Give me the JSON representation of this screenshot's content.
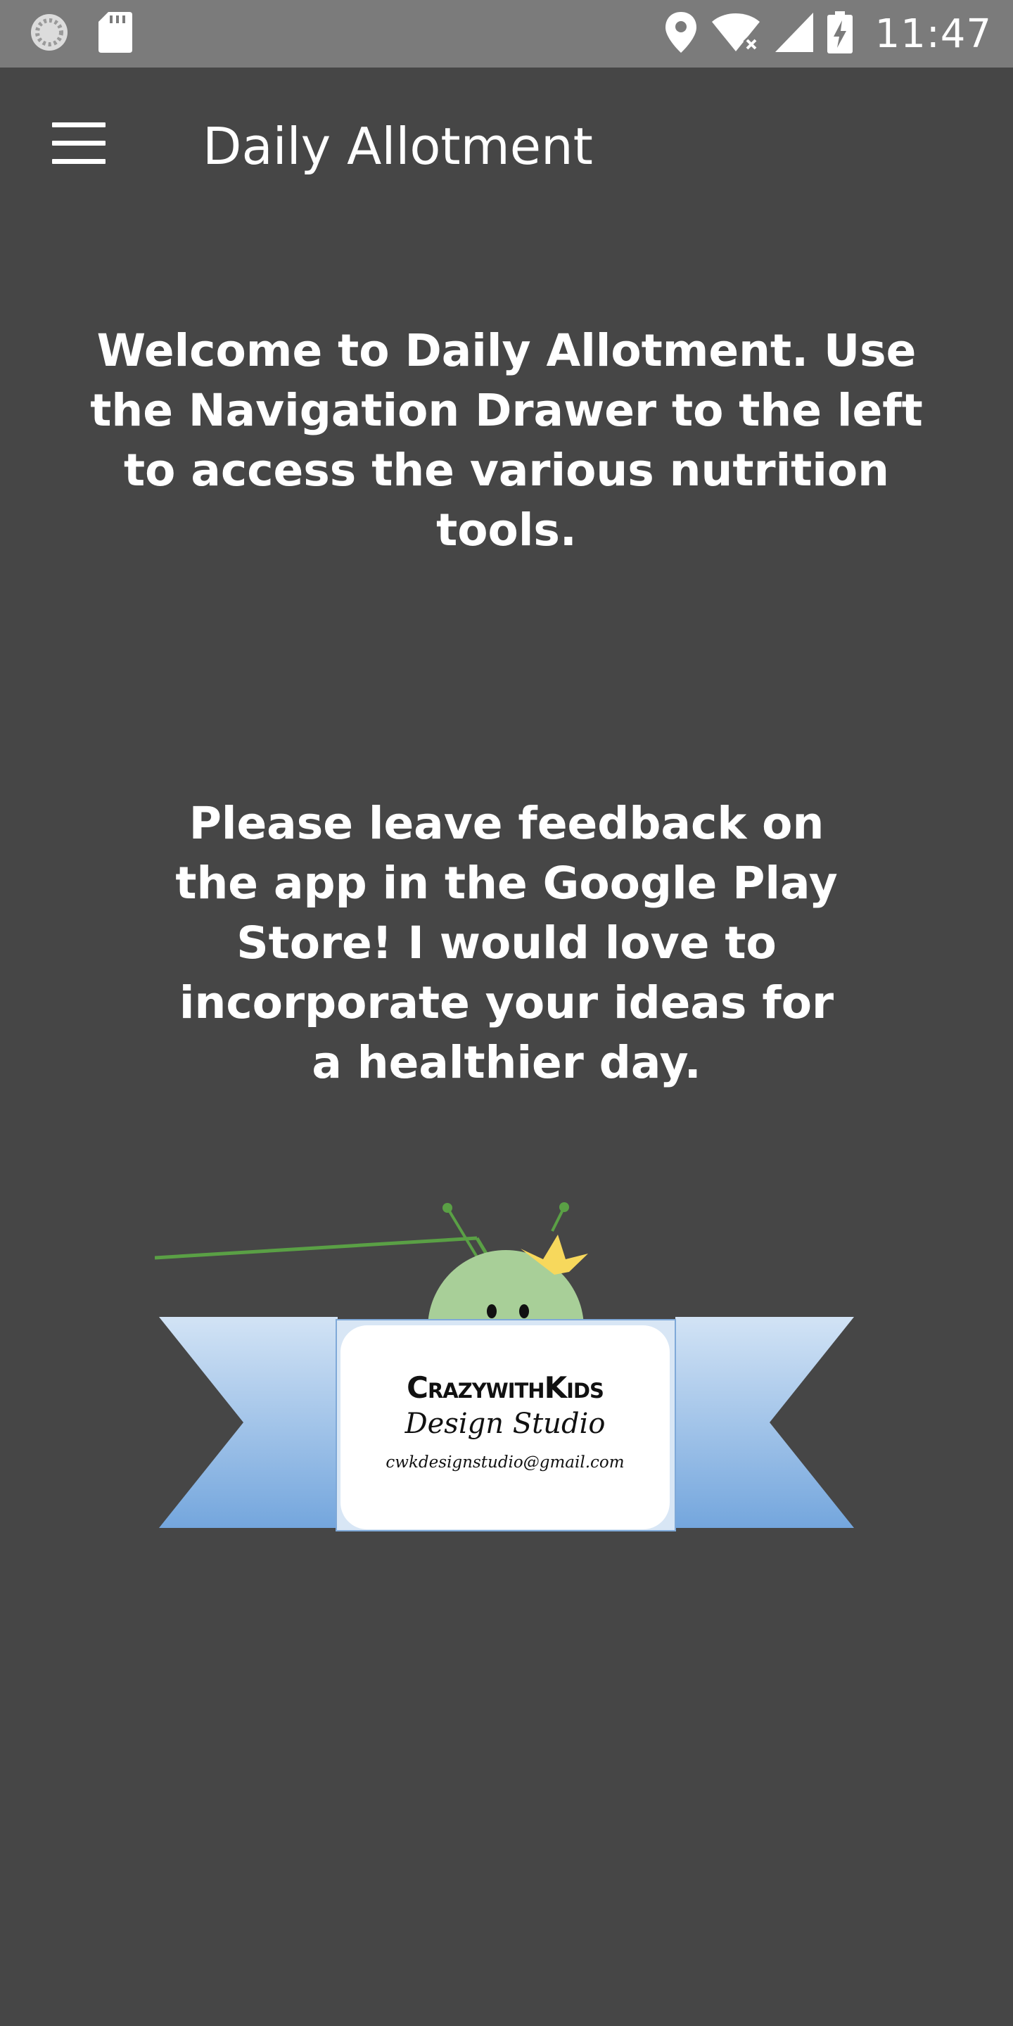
{
  "status_bar": {
    "time": "11:47",
    "left_icons": [
      "sync-icon",
      "sd-card-icon"
    ],
    "right_icons": [
      "location-icon",
      "wifi-off-icon",
      "signal-icon",
      "battery-charging-icon"
    ]
  },
  "app_bar": {
    "title": "Daily Allotment",
    "menu_icon": "hamburger-menu-icon"
  },
  "content": {
    "welcome": "Welcome to Daily Allotment. Use the Navigation Drawer to the left to access the various nutrition tools.",
    "feedback": "Please leave feedback on the app in the Google Play Store! I would love to incorporate your ideas for a healthier day."
  },
  "logo": {
    "name": "CrazywithKids",
    "subtitle": "Design Studio",
    "email": "cwkdesignstudio@gmail.com"
  },
  "colors": {
    "background": "#464646",
    "status_bar": "#7b7b7b",
    "text": "#ffffff",
    "ribbon": "#8db4e0",
    "mascot": "#a8cf98",
    "crown": "#f7d85c"
  }
}
